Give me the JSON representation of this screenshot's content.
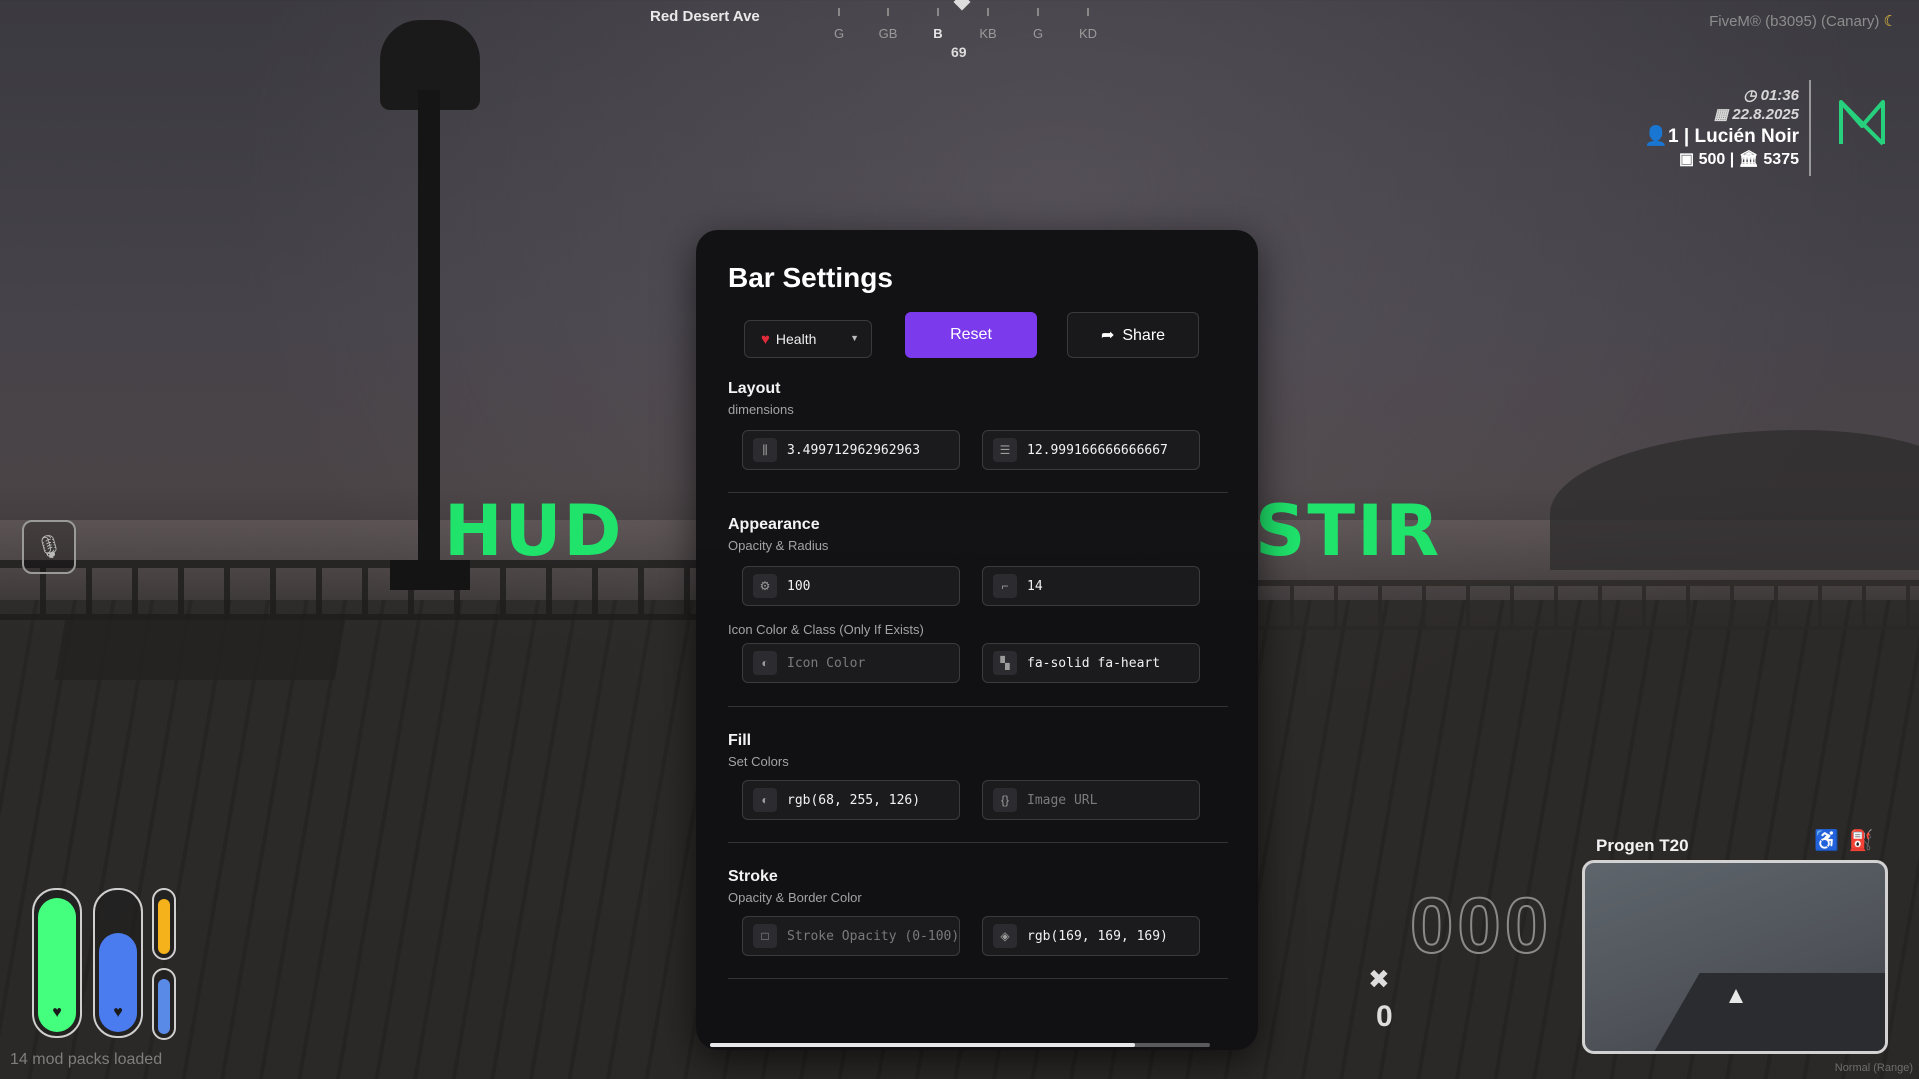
{
  "location": {
    "street": "Red Desert Ave",
    "heading": "69"
  },
  "compass": {
    "labels": [
      "G",
      "GB",
      "B",
      "KB",
      "G",
      "KD"
    ],
    "active": "B"
  },
  "build": {
    "text": "FiveM® (b3095) (Canary)"
  },
  "player_info": {
    "time": "01:36",
    "date": "22.8.2025",
    "player": "1 | Lucién Noir",
    "cash": "500",
    "bank": "5375"
  },
  "watermark": {
    "left": "HUD",
    "right": "STIR"
  },
  "status_bars": {
    "health": {
      "level": 0.97,
      "color": "#44ff7e"
    },
    "armor": {
      "level": 0.72,
      "color": "#4a7cf0"
    },
    "hunger": {
      "level": 0.92,
      "color": "#f5b21b"
    },
    "thirst": {
      "level": 0.92,
      "color": "#5a8ae8"
    }
  },
  "mods_loaded": "14 mod packs loaded",
  "panel": {
    "title": "Bar Settings",
    "dropdown_label": "Health",
    "reset_label": "Reset",
    "share_label": "Share",
    "layout": {
      "title": "Layout",
      "subtitle": "dimensions",
      "width_value": "3.499712962962963",
      "height_value": "12.999166666666667"
    },
    "appearance": {
      "title": "Appearance",
      "subtitle": "Opacity & Radius",
      "opacity_value": "100",
      "radius_value": "14",
      "icon_subtitle": "Icon Color & Class (Only If Exists)",
      "icon_color_placeholder": "Icon Color",
      "icon_class_value": "fa-solid fa-heart"
    },
    "fill": {
      "title": "Fill",
      "subtitle": "Set Colors",
      "color_value": "rgb(68, 255, 126)",
      "image_placeholder": "Image URL"
    },
    "stroke": {
      "title": "Stroke",
      "subtitle": "Opacity & Border Color",
      "opacity_placeholder": "Stroke Opacity (0-100)",
      "color_value": "rgb(169, 169, 169)"
    },
    "scroll_progress": 0.85
  },
  "vehicle": {
    "speed": "000",
    "gear": "0",
    "name": "Progen T20",
    "mode": "Normal (Range)"
  }
}
